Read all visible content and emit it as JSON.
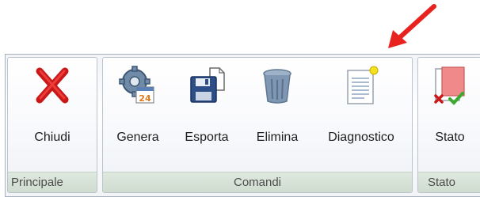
{
  "ribbon": {
    "groups": [
      {
        "caption": "Principale",
        "buttons": [
          {
            "label": "Chiudi",
            "icon": "close-icon"
          }
        ]
      },
      {
        "caption": "Comandi",
        "buttons": [
          {
            "label": "Genera",
            "icon": "gear-calendar-icon"
          },
          {
            "label": "Esporta",
            "icon": "floppy-export-icon"
          },
          {
            "label": "Elimina",
            "icon": "trash-icon"
          },
          {
            "label": "Diagnostico",
            "icon": "document-icon"
          }
        ]
      },
      {
        "caption": "Stato",
        "buttons": [
          {
            "label": "Stato",
            "icon": "status-icon"
          }
        ]
      }
    ]
  },
  "colors": {
    "arrow": "#e8231f",
    "close": "#d42020",
    "group_caption_bg": "#d6e2d6",
    "border": "#a8b2bf"
  }
}
